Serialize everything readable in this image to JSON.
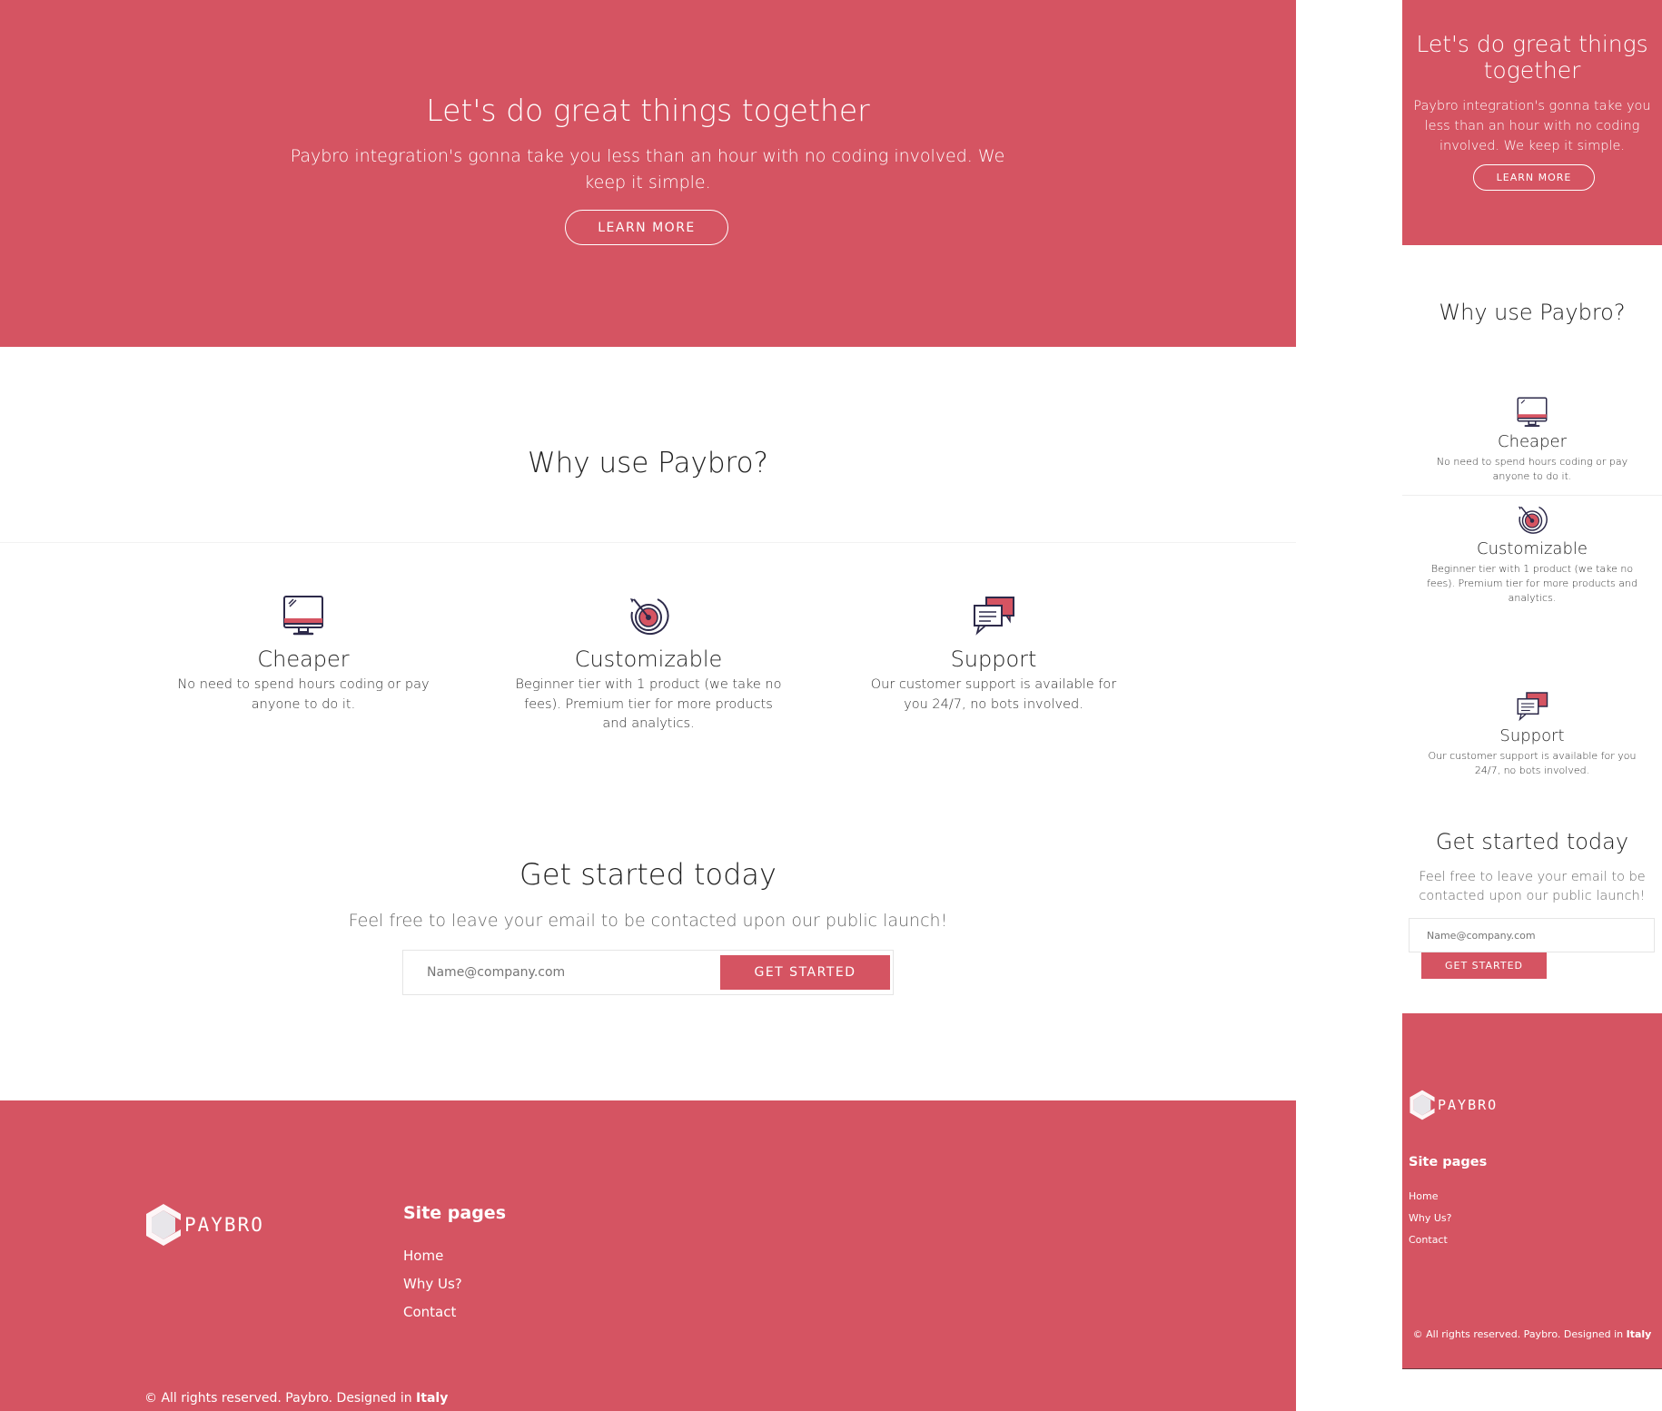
{
  "hero": {
    "title": "Let's do great things together",
    "text": "Paybro integration's gonna take you less than an hour with no coding involved. We keep it simple.",
    "button": "LEARN MORE"
  },
  "why": {
    "title": "Why use Paybro?",
    "features": [
      {
        "icon": "computer-icon",
        "title": "Cheaper",
        "text": "No need to spend hours coding or pay anyone to do it."
      },
      {
        "icon": "target-icon",
        "title": "Customizable",
        "text": "Beginner tier with 1 product (we take no fees). Premium tier for more products and analytics."
      },
      {
        "icon": "chat-icon",
        "title": "Support",
        "text": "Our customer support is available for you 24/7, no bots involved."
      }
    ]
  },
  "get_started": {
    "title": "Get started today",
    "text": "Feel free to leave your email to be contacted upon our public launch!",
    "placeholder": "Name@company.com",
    "button": "GET STARTED"
  },
  "footer": {
    "logo_text": "PAYBRO",
    "site_pages_title": "Site pages",
    "links": [
      "Home",
      "Why Us?",
      "Contact"
    ],
    "copyright": "© All rights reserved. Paybro. Designed in ",
    "copyright_strong": "Italy"
  },
  "colors": {
    "brand": "#d55462",
    "text": "#222222",
    "muted": "#6b6b6b"
  }
}
